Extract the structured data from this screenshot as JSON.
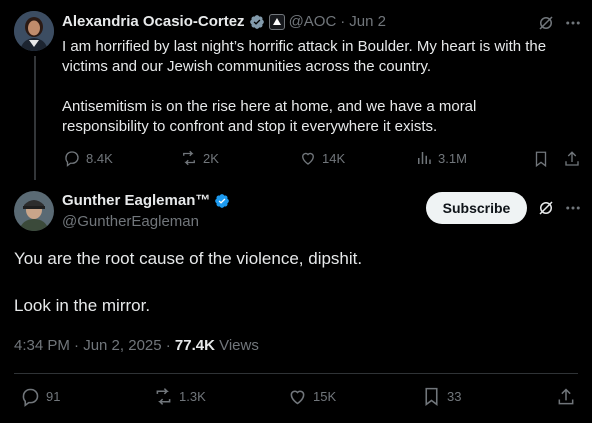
{
  "quoted_tweet": {
    "author_name": "Alexandria Ocasio-Cortez",
    "handle": "@AOC",
    "separator": "·",
    "date": "Jun 2",
    "paragraph1_line1": "I am horrified by last night’s horrific attack in Boulder. My heart is with the",
    "paragraph1_line2": "victims and our Jewish communities across the country.",
    "paragraph2_line1": "Antisemitism is on the rise here at home, and we have a moral",
    "paragraph2_line2": "responsibility to confront and stop it everywhere it exists.",
    "stats": {
      "replies": "8.4K",
      "reposts": "2K",
      "likes": "14K",
      "views": "3.1M"
    }
  },
  "reply_tweet": {
    "author_name": "Gunther Eagleman™",
    "handle": "@GuntherEagleman",
    "subscribe_label": "Subscribe",
    "line1": "You are the root cause of the violence, dipshit.",
    "line2": "Look in the mirror.",
    "timestamp": "4:34 PM · Jun 2, 2025 · ",
    "views_count": "77.4K",
    "views_label": " Views",
    "stats": {
      "replies": "91",
      "reposts": "1.3K",
      "likes": "15K",
      "bookmarks": "33"
    }
  },
  "colors": {
    "background": "#000000",
    "text": "#e7e9ea",
    "muted": "#71767b",
    "verified_blue": "#1d9bf0",
    "verified_gray": "#829aab",
    "divider": "#2f3336"
  },
  "icons": [
    "grok-icon",
    "more-icon",
    "reply-icon",
    "repost-icon",
    "like-icon",
    "views-icon",
    "bookmark-icon",
    "share-icon",
    "verified-badge-icon",
    "government-badge-icon"
  ]
}
